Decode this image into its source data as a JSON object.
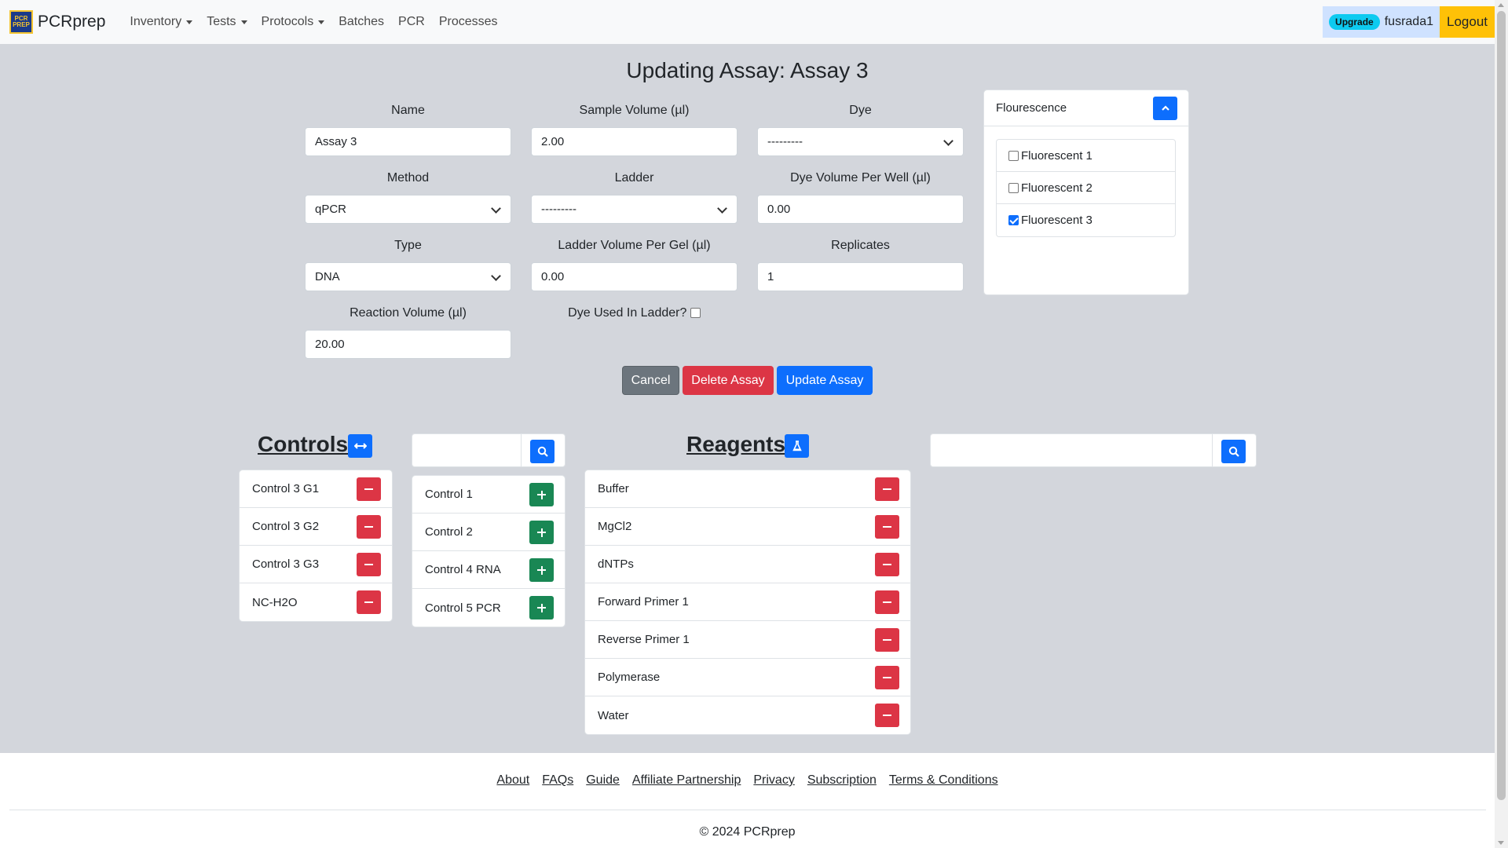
{
  "navbar": {
    "brand": "PCRprep",
    "logo_text": "PCR PREP",
    "items": [
      {
        "label": "Inventory",
        "dropdown": true
      },
      {
        "label": "Tests",
        "dropdown": true
      },
      {
        "label": "Protocols",
        "dropdown": true
      },
      {
        "label": "Batches",
        "dropdown": false
      },
      {
        "label": "PCR",
        "dropdown": false
      },
      {
        "label": "Processes",
        "dropdown": false
      }
    ],
    "upgrade_badge": "Upgrade",
    "username": "fusrada1",
    "logout": "Logout"
  },
  "page": {
    "title": "Updating Assay: Assay 3"
  },
  "form": {
    "name": {
      "label": "Name",
      "value": "Assay 3"
    },
    "sample_volume": {
      "label": "Sample Volume (µl)",
      "value": "2.00"
    },
    "dye": {
      "label": "Dye",
      "value": "---------"
    },
    "method": {
      "label": "Method",
      "value": "qPCR"
    },
    "ladder": {
      "label": "Ladder",
      "value": "---------"
    },
    "dye_volume": {
      "label": "Dye Volume Per Well (µl)",
      "value": "0.00"
    },
    "type": {
      "label": "Type",
      "value": "DNA"
    },
    "ladder_volume": {
      "label": "Ladder Volume Per Gel (µl)",
      "value": "0.00"
    },
    "replicates": {
      "label": "Replicates",
      "value": "1"
    },
    "reaction_volume": {
      "label": "Reaction Volume (µl)",
      "value": "20.00"
    },
    "dye_used_in_ladder": {
      "label": "Dye Used In Ladder?",
      "checked": false
    }
  },
  "buttons": {
    "cancel": "Cancel",
    "delete": "Delete Assay",
    "update": "Update Assay"
  },
  "fluorescence": {
    "title": "Flourescence",
    "items": [
      {
        "label": "Fluorescent 1",
        "checked": false
      },
      {
        "label": "Fluorescent 2",
        "checked": false
      },
      {
        "label": "Fluorescent 3",
        "checked": true
      }
    ]
  },
  "controls": {
    "title": "Controls",
    "selected": [
      "Control 3 G1",
      "Control 3 G2",
      "Control 3 G3",
      "NC-H2O"
    ],
    "search_value": "",
    "available": [
      "Control 1",
      "Control 2",
      "Control 4 RNA",
      "Control 5 PCR"
    ]
  },
  "reagents": {
    "title": "Reagents",
    "selected": [
      "Buffer",
      "MgCl2",
      "dNTPs",
      "Forward Primer 1",
      "Reverse Primer 1",
      "Polymerase",
      "Water"
    ],
    "search_value": ""
  },
  "footer": {
    "links": [
      "About",
      "FAQs",
      "Guide",
      "Affiliate Partnership",
      "Privacy",
      "Subscription",
      "Terms & Conditions"
    ],
    "copyright": "© 2024 PCRprep"
  },
  "colors": {
    "primary": "#0d6efd",
    "danger": "#dc3545",
    "success": "#198754",
    "secondary": "#6c757d",
    "warning": "#ffc107",
    "info": "#0dcaf0"
  }
}
